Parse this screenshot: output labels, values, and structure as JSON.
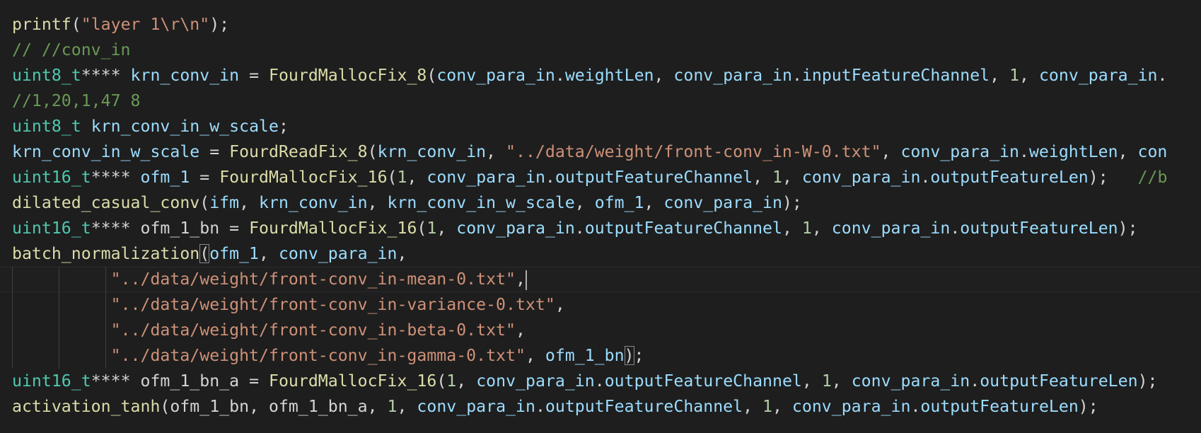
{
  "editor": {
    "theme": {
      "background": "#1e1e1e",
      "function": "#dcdcaa",
      "string": "#ce9178",
      "comment": "#6a9955",
      "type": "#4ec9b0",
      "variable": "#9cdcfe",
      "number": "#b5cea8",
      "punctuation": "#d4d4d4"
    },
    "cursor": {
      "line": 11,
      "after_text": "\"../data/weight/front-conv_in-mean-0.txt\","
    },
    "lines": [
      [
        [
          "fn",
          "printf"
        ],
        [
          "punc",
          "("
        ],
        [
          "str",
          "\"layer 1\\r\\n\""
        ],
        [
          "punc",
          ");"
        ]
      ],
      [
        [
          "com",
          "// //conv_in"
        ]
      ],
      [
        [
          "type",
          "uint8_t"
        ],
        [
          "punc",
          "**** "
        ],
        [
          "var",
          "krn_conv_in"
        ],
        [
          "punc",
          " = "
        ],
        [
          "fn",
          "FourdMallocFix_8"
        ],
        [
          "punc",
          "("
        ],
        [
          "var",
          "conv_para_in"
        ],
        [
          "punc",
          "."
        ],
        [
          "var",
          "weightLen"
        ],
        [
          "punc",
          ", "
        ],
        [
          "var",
          "conv_para_in"
        ],
        [
          "punc",
          "."
        ],
        [
          "var",
          "inputFeatureChannel"
        ],
        [
          "punc",
          ", "
        ],
        [
          "num",
          "1"
        ],
        [
          "punc",
          ", "
        ],
        [
          "var",
          "conv_para_in"
        ],
        [
          "punc",
          "."
        ]
      ],
      [
        [
          "com",
          "//1,20,1,47 8"
        ]
      ],
      [
        [
          "type",
          "uint8_t"
        ],
        [
          "punc",
          " "
        ],
        [
          "var",
          "krn_conv_in_w_scale"
        ],
        [
          "punc",
          ";"
        ]
      ],
      [
        [
          "var",
          "krn_conv_in_w_scale"
        ],
        [
          "punc",
          " = "
        ],
        [
          "fn",
          "FourdReadFix_8"
        ],
        [
          "punc",
          "("
        ],
        [
          "var",
          "krn_conv_in"
        ],
        [
          "punc",
          ", "
        ],
        [
          "str",
          "\"../data/weight/front-conv_in-W-0.txt\""
        ],
        [
          "punc",
          ", "
        ],
        [
          "var",
          "conv_para_in"
        ],
        [
          "punc",
          "."
        ],
        [
          "var",
          "weightLen"
        ],
        [
          "punc",
          ", "
        ],
        [
          "var",
          "con"
        ]
      ],
      [
        [
          "type",
          "uint16_t"
        ],
        [
          "punc",
          "**** "
        ],
        [
          "var",
          "ofm_1"
        ],
        [
          "punc",
          " = "
        ],
        [
          "fn",
          "FourdMallocFix_16"
        ],
        [
          "punc",
          "("
        ],
        [
          "num",
          "1"
        ],
        [
          "punc",
          ", "
        ],
        [
          "var",
          "conv_para_in"
        ],
        [
          "punc",
          "."
        ],
        [
          "var",
          "outputFeatureChannel"
        ],
        [
          "punc",
          ", "
        ],
        [
          "num",
          "1"
        ],
        [
          "punc",
          ", "
        ],
        [
          "var",
          "conv_para_in"
        ],
        [
          "punc",
          "."
        ],
        [
          "var",
          "outputFeatureLen"
        ],
        [
          "punc",
          ");   "
        ],
        [
          "com",
          "//b"
        ]
      ],
      [
        [
          "fn",
          "dilated_casual_conv"
        ],
        [
          "punc",
          "("
        ],
        [
          "var",
          "ifm"
        ],
        [
          "punc",
          ", "
        ],
        [
          "var",
          "krn_conv_in"
        ],
        [
          "punc",
          ", "
        ],
        [
          "var",
          "krn_conv_in_w_scale"
        ],
        [
          "punc",
          ", "
        ],
        [
          "var",
          "ofm_1"
        ],
        [
          "punc",
          ", "
        ],
        [
          "var",
          "conv_para_in"
        ],
        [
          "punc",
          ");"
        ]
      ],
      [
        [
          "type",
          "uint16_t"
        ],
        [
          "punc",
          "**** "
        ],
        [
          "plain",
          "ofm_1_bn"
        ],
        [
          "punc",
          " = "
        ],
        [
          "fn",
          "FourdMallocFix_16"
        ],
        [
          "punc",
          "("
        ],
        [
          "num",
          "1"
        ],
        [
          "punc",
          ", "
        ],
        [
          "var",
          "conv_para_in"
        ],
        [
          "punc",
          "."
        ],
        [
          "var",
          "outputFeatureChannel"
        ],
        [
          "punc",
          ", "
        ],
        [
          "num",
          "1"
        ],
        [
          "punc",
          ", "
        ],
        [
          "var",
          "conv_para_in"
        ],
        [
          "punc",
          "."
        ],
        [
          "var",
          "outputFeatureLen"
        ],
        [
          "punc",
          ");"
        ]
      ],
      [
        [
          "fn",
          "batch_normalization"
        ],
        [
          "punc",
          "("
        ],
        [
          "var",
          "ofm_1"
        ],
        [
          "punc",
          ", "
        ],
        [
          "var",
          "conv_para_in"
        ],
        [
          "punc",
          ","
        ]
      ],
      [
        [
          "punc",
          "          "
        ],
        [
          "str",
          "\"../data/weight/front-conv_in-mean-0.txt\""
        ],
        [
          "punc",
          ","
        ]
      ],
      [
        [
          "punc",
          "          "
        ],
        [
          "str",
          "\"../data/weight/front-conv_in-variance-0.txt\""
        ],
        [
          "punc",
          ","
        ]
      ],
      [
        [
          "punc",
          "          "
        ],
        [
          "str",
          "\"../data/weight/front-conv_in-beta-0.txt\""
        ],
        [
          "punc",
          ","
        ]
      ],
      [
        [
          "punc",
          "          "
        ],
        [
          "str",
          "\"../data/weight/front-conv_in-gamma-0.txt\""
        ],
        [
          "punc",
          ", "
        ],
        [
          "var",
          "ofm_1_bn"
        ],
        [
          "punc",
          ");"
        ]
      ],
      [
        [
          "type",
          "uint16_t"
        ],
        [
          "punc",
          "**** "
        ],
        [
          "plain",
          "ofm_1_bn_a"
        ],
        [
          "punc",
          " = "
        ],
        [
          "fn",
          "FourdMallocFix_16"
        ],
        [
          "punc",
          "("
        ],
        [
          "num",
          "1"
        ],
        [
          "punc",
          ", "
        ],
        [
          "var",
          "conv_para_in"
        ],
        [
          "punc",
          "."
        ],
        [
          "var",
          "outputFeatureChannel"
        ],
        [
          "punc",
          ", "
        ],
        [
          "num",
          "1"
        ],
        [
          "punc",
          ", "
        ],
        [
          "var",
          "conv_para_in"
        ],
        [
          "punc",
          "."
        ],
        [
          "var",
          "outputFeatureLen"
        ],
        [
          "punc",
          ");"
        ]
      ],
      [
        [
          "fn",
          "activation_tanh"
        ],
        [
          "punc",
          "("
        ],
        [
          "plain",
          "ofm_1_bn"
        ],
        [
          "punc",
          ", "
        ],
        [
          "plain",
          "ofm_1_bn_a"
        ],
        [
          "punc",
          ", "
        ],
        [
          "num",
          "1"
        ],
        [
          "punc",
          ", "
        ],
        [
          "var",
          "conv_para_in"
        ],
        [
          "punc",
          "."
        ],
        [
          "var",
          "outputFeatureChannel"
        ],
        [
          "punc",
          ", "
        ],
        [
          "num",
          "1"
        ],
        [
          "punc",
          ", "
        ],
        [
          "var",
          "conv_para_in"
        ],
        [
          "punc",
          "."
        ],
        [
          "var",
          "outputFeatureLen"
        ],
        [
          "punc",
          ");"
        ]
      ]
    ]
  }
}
